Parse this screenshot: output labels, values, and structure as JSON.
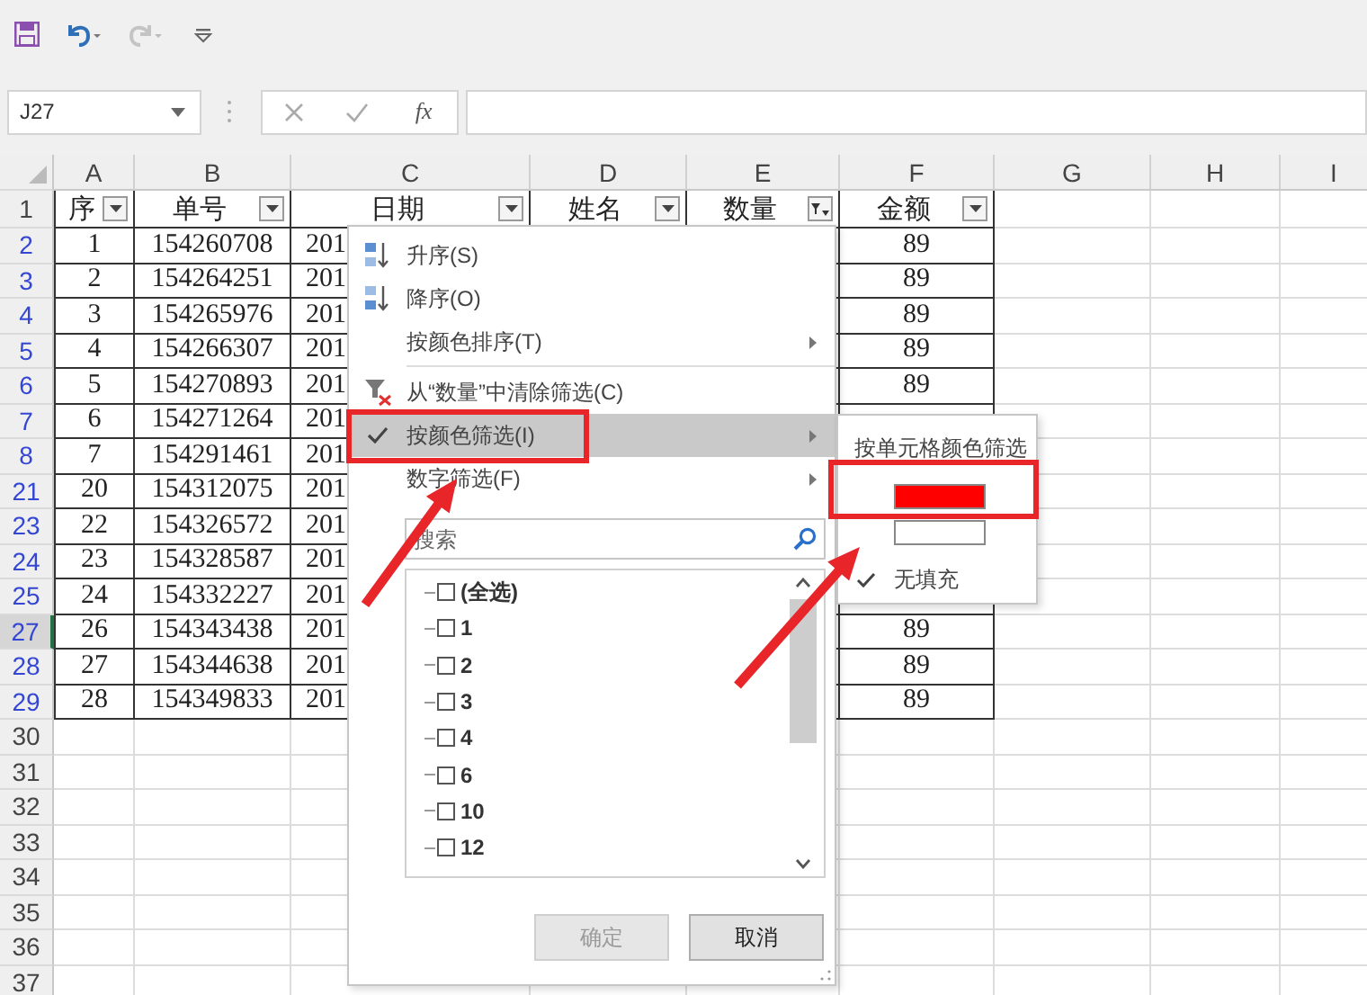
{
  "quick_access": [
    {
      "kind": "save",
      "disabled": false
    },
    {
      "kind": "undo",
      "disabled": false
    },
    {
      "kind": "redo",
      "disabled": true
    },
    {
      "kind": "customize",
      "disabled": false
    }
  ],
  "name_box": "J27",
  "insert_function": "fx",
  "columns": [
    "A",
    "B",
    "C",
    "D",
    "E",
    "F",
    "G",
    "H",
    "I"
  ],
  "header_row": {
    "number": "1",
    "cells": [
      {
        "label": "序",
        "filter_applied": false
      },
      {
        "label": "单号",
        "filter_applied": false
      },
      {
        "label": "日期",
        "filter_applied": false
      },
      {
        "label": "姓名",
        "filter_applied": false
      },
      {
        "label": "数量",
        "filter_applied": true
      },
      {
        "label": "金额",
        "filter_applied": false
      }
    ]
  },
  "rows": [
    {
      "number": "2",
      "filtered": true,
      "active": false,
      "a": "1",
      "b": "154260708",
      "c": "201",
      "f": "89"
    },
    {
      "number": "3",
      "filtered": true,
      "active": false,
      "a": "2",
      "b": "154264251",
      "c": "201",
      "f": "89"
    },
    {
      "number": "4",
      "filtered": true,
      "active": false,
      "a": "3",
      "b": "154265976",
      "c": "201",
      "f": "89"
    },
    {
      "number": "5",
      "filtered": true,
      "active": false,
      "a": "4",
      "b": "154266307",
      "c": "201",
      "f": "89"
    },
    {
      "number": "6",
      "filtered": true,
      "active": false,
      "a": "5",
      "b": "154270893",
      "c": "201",
      "f": "89"
    },
    {
      "number": "7",
      "filtered": true,
      "active": false,
      "a": "6",
      "b": "154271264",
      "c": "201"
    },
    {
      "number": "8",
      "filtered": true,
      "active": false,
      "a": "7",
      "b": "154291461",
      "c": "201"
    },
    {
      "number": "21",
      "filtered": true,
      "active": false,
      "a": "20",
      "b": "154312075",
      "c": "201"
    },
    {
      "number": "23",
      "filtered": true,
      "active": false,
      "a": "22",
      "b": "154326572",
      "c": "201"
    },
    {
      "number": "24",
      "filtered": true,
      "active": false,
      "a": "23",
      "b": "154328587",
      "c": "201"
    },
    {
      "number": "25",
      "filtered": true,
      "active": false,
      "a": "24",
      "b": "154332227",
      "c": "201"
    },
    {
      "number": "27",
      "filtered": true,
      "active": true,
      "a": "26",
      "b": "154343438",
      "c": "201",
      "f": "89"
    },
    {
      "number": "28",
      "filtered": true,
      "active": false,
      "a": "27",
      "b": "154344638",
      "c": "201",
      "f": "89"
    },
    {
      "number": "29",
      "filtered": true,
      "active": false,
      "a": "28",
      "b": "154349833",
      "c": "201",
      "f": "89"
    },
    {
      "number": "30",
      "filtered": false,
      "active": false
    },
    {
      "number": "31",
      "filtered": false,
      "active": false
    },
    {
      "number": "32",
      "filtered": false,
      "active": false
    },
    {
      "number": "33",
      "filtered": false,
      "active": false
    },
    {
      "number": "34",
      "filtered": false,
      "active": false
    },
    {
      "number": "35",
      "filtered": false,
      "active": false
    },
    {
      "number": "36",
      "filtered": false,
      "active": false
    },
    {
      "number": "37",
      "filtered": false,
      "active": false
    }
  ],
  "filter_menu": {
    "items": [
      {
        "kind": "sort-asc",
        "label": "升序(S)",
        "submenu": false,
        "checked": false,
        "selected": false
      },
      {
        "kind": "sort-desc",
        "label": "降序(O)",
        "submenu": false,
        "checked": false,
        "selected": false
      },
      {
        "kind": "plain",
        "label": "按颜色排序(T)",
        "submenu": true,
        "checked": false,
        "selected": false
      },
      {
        "kind": "separator"
      },
      {
        "kind": "clear-filter",
        "label": "从“数量”中清除筛选(C)",
        "submenu": false,
        "checked": false,
        "selected": false
      },
      {
        "kind": "plain",
        "label": "按颜色筛选(I)",
        "submenu": true,
        "checked": true,
        "selected": true
      },
      {
        "kind": "plain",
        "label": "数字筛选(F)",
        "submenu": true,
        "checked": false,
        "selected": false
      }
    ],
    "search": {
      "placeholder": "搜索"
    },
    "values": [
      {
        "label": "(全选)",
        "checked": false
      },
      {
        "label": "1",
        "checked": false
      },
      {
        "label": "2",
        "checked": false
      },
      {
        "label": "3",
        "checked": false
      },
      {
        "label": "4",
        "checked": false
      },
      {
        "label": "6",
        "checked": false
      },
      {
        "label": "10",
        "checked": false
      },
      {
        "label": "12",
        "checked": false
      }
    ],
    "buttons": [
      {
        "label": "确定",
        "disabled": true
      },
      {
        "label": "取消",
        "disabled": false
      }
    ]
  },
  "color_submenu": {
    "title": "按单元格颜色筛选",
    "colors": [
      {
        "color": "#ff0000",
        "checked": false
      },
      {
        "color": "#ffffff",
        "checked": false
      }
    ],
    "no_fill": {
      "label": "无填充",
      "checked": true
    }
  },
  "annotations": [
    {
      "kind": "box"
    },
    {
      "kind": "box"
    },
    {
      "kind": "arrow"
    },
    {
      "kind": "arrow"
    }
  ]
}
